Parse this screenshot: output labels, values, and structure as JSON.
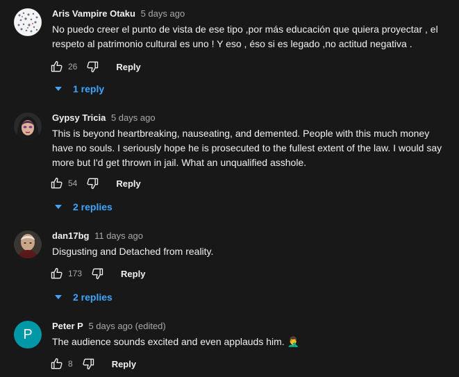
{
  "comments": [
    {
      "author": "Aris Vampire Otaku",
      "time": "5 days ago",
      "text": "No puedo creer el punto de vista de ese tipo ,por más educación que quiera proyectar , el respeto al patrimonio cultural es uno ! Y eso , éso si es legado ,no actitud negativa .",
      "likes": "26",
      "reply_label": "Reply",
      "replies_label": "1 reply"
    },
    {
      "author": "Gypsy Tricia",
      "time": "5 days ago",
      "text": "This is beyond heartbreaking, nauseating, and demented. People with this much money have no souls. I seriously hope he is prosecuted to the fullest extent of the law. I would say more but I'd get thrown in jail. What an unqualified asshole.",
      "likes": "54",
      "reply_label": "Reply",
      "replies_label": "2 replies"
    },
    {
      "author": "dan17bg",
      "time": "11 days ago",
      "text": "Disgusting and Detached from reality.",
      "likes": "173",
      "reply_label": "Reply",
      "replies_label": "2 replies"
    },
    {
      "author": "Peter P",
      "time": "5 days ago (edited)",
      "text": "The audience sounds excited and even applauds him. 🤦‍♂️",
      "likes": "8",
      "reply_label": "Reply",
      "avatar_letter": "P",
      "avatar_color": "#0097a7"
    }
  ],
  "colors": {
    "link": "#3ea6ff",
    "muted": "#aaaaaa",
    "background": "#181818"
  }
}
